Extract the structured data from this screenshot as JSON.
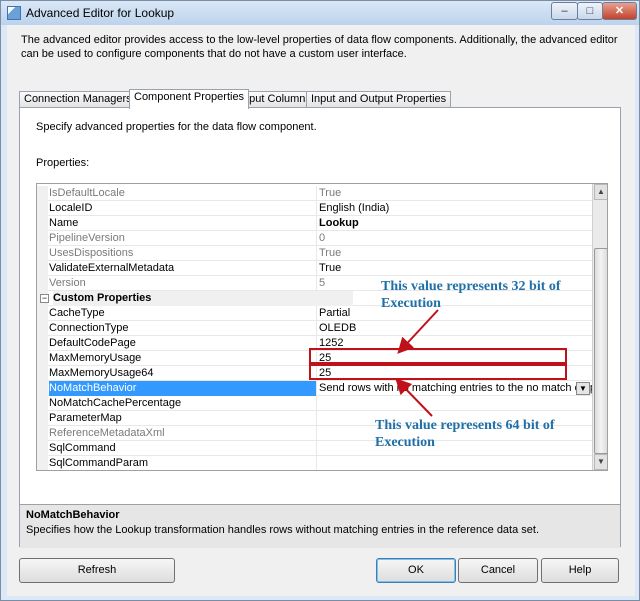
{
  "window": {
    "title": "Advanced Editor for Lookup"
  },
  "description": "The advanced editor provides access to the low-level properties of data flow components. Additionally, the advanced editor can be used to configure components that do not have a custom user interface.",
  "tabs": [
    {
      "label": "Connection Managers"
    },
    {
      "label": "Component Properties"
    },
    {
      "label": "Input Columns"
    },
    {
      "label": "Input and Output Properties"
    }
  ],
  "panel": {
    "heading": "Specify advanced properties for the data flow component.",
    "properties_label": "Properties:"
  },
  "grid": {
    "rows": [
      {
        "name": "IsDefaultLocale",
        "value": "True"
      },
      {
        "name": "LocaleID",
        "value": "English (India)"
      },
      {
        "name": "Name",
        "value": "Lookup"
      },
      {
        "name": "PipelineVersion",
        "value": "0"
      },
      {
        "name": "UsesDispositions",
        "value": "True"
      },
      {
        "name": "ValidateExternalMetadata",
        "value": "True"
      },
      {
        "name": "Version",
        "value": "5"
      },
      {
        "name": "Custom Properties",
        "value": ""
      },
      {
        "name": "CacheType",
        "value": "Partial"
      },
      {
        "name": "ConnectionType",
        "value": "OLEDB"
      },
      {
        "name": "DefaultCodePage",
        "value": "1252"
      },
      {
        "name": "MaxMemoryUsage",
        "value": "25"
      },
      {
        "name": "MaxMemoryUsage64",
        "value": "25"
      },
      {
        "name": "NoMatchBehavior",
        "value": "Send rows with no matching entries to the no match output."
      },
      {
        "name": "NoMatchCachePercentage",
        "value": ""
      },
      {
        "name": "ParameterMap",
        "value": ""
      },
      {
        "name": "ReferenceMetadataXml",
        "value": ""
      },
      {
        "name": "SqlCommand",
        "value": ""
      },
      {
        "name": "SqlCommandParam",
        "value": ""
      }
    ],
    "collapse_glyph": "−"
  },
  "help": {
    "title": "NoMatchBehavior",
    "text": "Specifies how the Lookup transformation handles rows without matching entries in the reference data set."
  },
  "buttons": {
    "refresh": "Refresh",
    "ok": "OK",
    "cancel": "Cancel",
    "help": "Help"
  },
  "annotations": {
    "top_line1": "This value represents 32 bit of",
    "top_line2": "Execution",
    "bottom_line1": "This value represents 64 bit of",
    "bottom_line2": "Execution"
  },
  "colors": {
    "annotation": "#1f6fa8",
    "highlight": "#c0101a",
    "selection": "#3399ff"
  }
}
